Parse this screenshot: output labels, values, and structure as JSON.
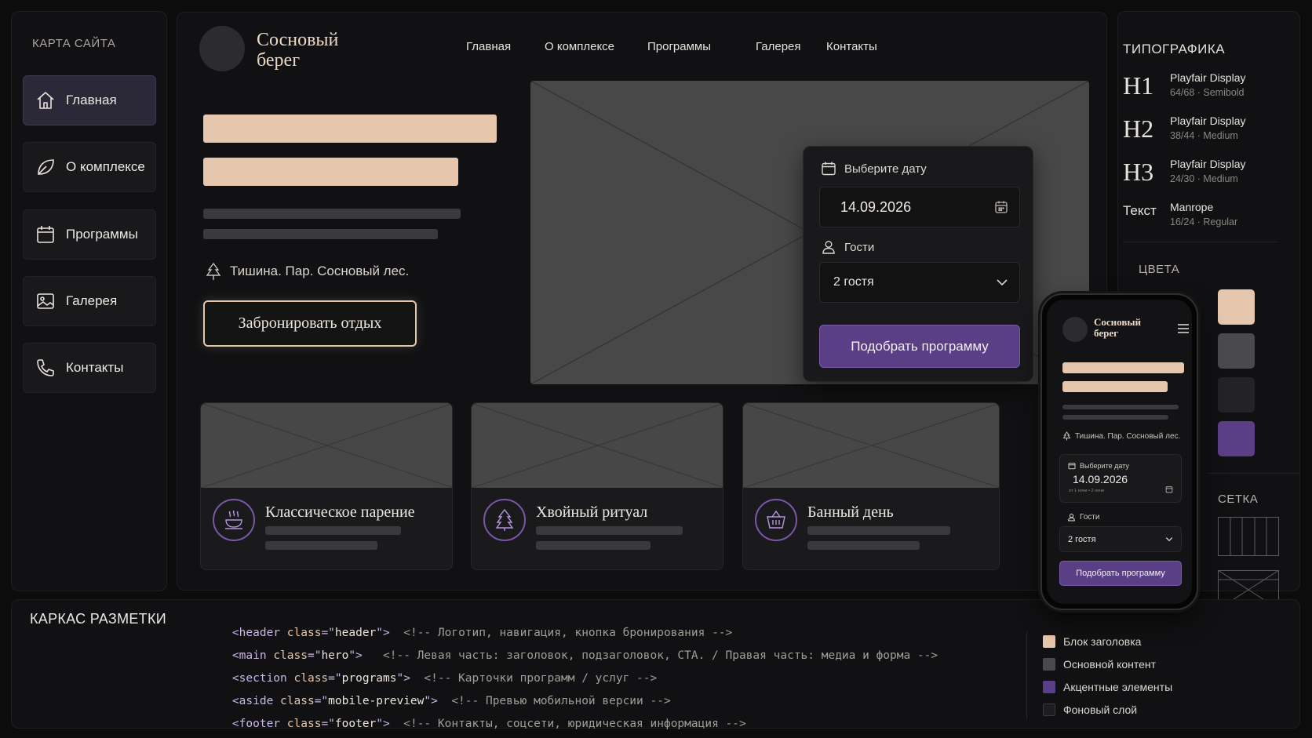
{
  "sitemap": {
    "title": "КАРТА САЙТА",
    "items": [
      {
        "label": "Главная",
        "icon": "home-icon"
      },
      {
        "label": "О комплексе",
        "icon": "leaf-icon"
      },
      {
        "label": "Программы",
        "icon": "calendar-icon"
      },
      {
        "label": "Галерея",
        "icon": "image-icon"
      },
      {
        "label": "Контакты",
        "icon": "phone-icon"
      }
    ]
  },
  "header": {
    "logo_line1": "Сосновый",
    "logo_line2": "берег",
    "nav": [
      "Главная",
      "О комплексе",
      "Программы",
      "Галерея",
      "Контакты"
    ]
  },
  "hero": {
    "tagline": "Тишина. Пар. Сосновый лес.",
    "cta": "Забронировать отдых"
  },
  "booking": {
    "date_label": "Выберите дату",
    "date_value": "14.09.2026",
    "guests_label": "Гости",
    "guests_value": "2 гостя",
    "submit": "Подобрать программу"
  },
  "programs": [
    {
      "title": "Классическое парение",
      "icon": "steam-bowl-icon"
    },
    {
      "title": "Хвойный ритуал",
      "icon": "pine-tree-icon"
    },
    {
      "title": "Банный день",
      "icon": "basket-icon"
    }
  ],
  "typography": {
    "title": "ТИПОГРАФИКА",
    "rows": [
      {
        "sample": "H1",
        "name": "Playfair Display",
        "meta": "64/68 · Semibold"
      },
      {
        "sample": "H2",
        "name": "Playfair Display",
        "meta": "38/44 · Medium"
      },
      {
        "sample": "H3",
        "name": "Playfair Display",
        "meta": "24/30 · Medium"
      },
      {
        "sample": "Текст",
        "name": "Manrope",
        "meta": "16/24 · Regular"
      }
    ],
    "colors_title": "ЦВЕТА",
    "colors": [
      "#e6c7ad",
      "#4a4a4c",
      "#232325",
      "#5b3f86"
    ],
    "grid_title": "СЕТКА"
  },
  "mobile": {
    "logo_line1": "Сосновый",
    "logo_line2": "берег",
    "tagline": "Тишина. Пар. Сосновый лес.",
    "date_label": "Выберите дату",
    "date_value": "14.09.2026",
    "date_hint": "от 1 ночи • 2 ночи",
    "guests_label": "Гости",
    "guests_value": "2 гостя",
    "submit": "Подобрать программу"
  },
  "markup": {
    "title": "КАРКАС РАЗМЕТКИ",
    "lines": [
      {
        "tag": "header",
        "cls": "header",
        "comment": "<!-- Логотип, навигация, кнопка бронирования -->"
      },
      {
        "tag": "main",
        "cls": "hero",
        "comment": "<!-- Левая часть: заголовок, подзаголовок, CTA. / Правая часть: медиа и форма -->"
      },
      {
        "tag": "section",
        "cls": "programs",
        "comment": "<!-- Карточки программ / услуг -->"
      },
      {
        "tag": "aside",
        "cls": "mobile-preview",
        "comment": "<!-- Превью мобильной версии -->"
      },
      {
        "tag": "footer",
        "cls": "footer",
        "comment": "<!-- Контакты, соцсети, юридическая информация -->"
      }
    ],
    "legend": [
      {
        "label": "Блок заголовка",
        "color": "#e6c7ad"
      },
      {
        "label": "Основной контент",
        "color": "#4a4a4c"
      },
      {
        "label": "Акцентные элементы",
        "color": "#5b3f86"
      },
      {
        "label": "Фоновый слой",
        "color": "#1d1d1f"
      }
    ]
  }
}
